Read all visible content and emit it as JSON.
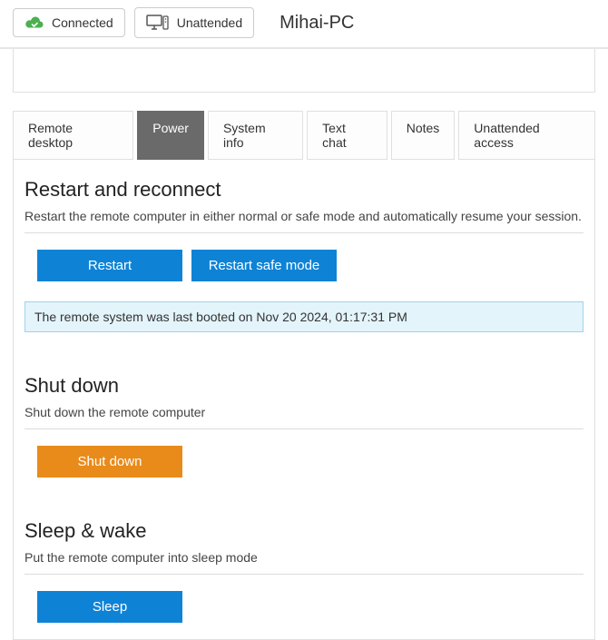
{
  "topbar": {
    "connected_label": "Connected",
    "unattended_label": "Unattended",
    "device_name": "Mihai-PC"
  },
  "tabs": [
    {
      "label": "Remote desktop"
    },
    {
      "label": "Power"
    },
    {
      "label": "System info"
    },
    {
      "label": "Text chat"
    },
    {
      "label": "Notes"
    },
    {
      "label": "Unattended access"
    }
  ],
  "sections": {
    "restart": {
      "heading": "Restart and reconnect",
      "desc": "Restart the remote computer in either normal or safe mode and automatically resume your session.",
      "btn_restart": "Restart",
      "btn_restart_safe": "Restart safe mode",
      "info": "The remote system was last booted on Nov 20 2024, 01:17:31 PM"
    },
    "shutdown": {
      "heading": "Shut down",
      "desc": "Shut down the remote computer",
      "btn_shutdown": "Shut down"
    },
    "sleep": {
      "heading": "Sleep & wake",
      "desc": "Put the remote computer into sleep mode",
      "btn_sleep": "Sleep"
    }
  }
}
